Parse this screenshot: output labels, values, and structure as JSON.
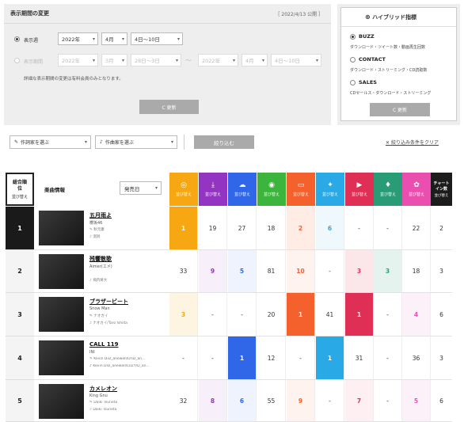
{
  "period": {
    "title": "表示期間の変更",
    "published": "［ 2022/4/13 公開 ］",
    "week_label": "表示週",
    "week_year": "2022年",
    "week_month": "4月",
    "week_range": "4日〜10日",
    "range_label": "表示期間",
    "from_year": "2022年",
    "from_month": "3月",
    "from_range": "28日〜3日",
    "tilde": "〜",
    "to_year": "2022年",
    "to_month": "4月",
    "to_range": "4日〜10日",
    "note": "詳細な表示期間の変更は有料会員のみとなります。",
    "update_label": "C 更新"
  },
  "hybrid": {
    "title": "ハイブリッド指標",
    "options": [
      {
        "name": "BUZZ",
        "desc": "ダウンロード・ツイート数・動画再生回数"
      },
      {
        "name": "CONTACT",
        "desc": "ダウンロード・ストリーミング・CD読取数"
      },
      {
        "name": "SALES",
        "desc": "CDセールス・ダウンロード・ストリーミング"
      }
    ],
    "update_label": "C 更新"
  },
  "filters": {
    "lyricist": "作詞家を選ぶ",
    "composer": "作曲家を選ぶ",
    "narrow": "絞り込む",
    "clear": "絞り込み条件をクリア"
  },
  "header": {
    "overall": "総合順位",
    "sort": "並び替え",
    "song_info": "楽曲情報",
    "release": "発売日",
    "chart_in": "チャートイン数",
    "columns": [
      {
        "name": "sales-column",
        "icon": "cd-icon",
        "color": "#f7a711"
      },
      {
        "name": "download-column",
        "icon": "download-icon",
        "color": "#9334c2"
      },
      {
        "name": "streaming-column",
        "icon": "cloud-icon",
        "color": "#2f67e8"
      },
      {
        "name": "radio-column",
        "icon": "radio-icon",
        "color": "#3cb53c"
      },
      {
        "name": "karaoke-room-column",
        "icon": "tv-icon",
        "color": "#f4612d"
      },
      {
        "name": "twitter-column",
        "icon": "twitter-icon",
        "color": "#29a9e6"
      },
      {
        "name": "youtube-column",
        "icon": "youtube-icon",
        "color": "#e02f55"
      },
      {
        "name": "karaoke-column",
        "icon": "microphone-icon",
        "color": "#2a9b77"
      },
      {
        "name": "gyao-column",
        "icon": "gyao-icon",
        "color": "#ea4fb0"
      }
    ]
  },
  "rows": [
    {
      "rank": "1",
      "title": "五月雨よ",
      "artist": "櫻坂46",
      "credit1": "秋元康",
      "credit2": "温詞",
      "values": [
        "1",
        "19",
        "27",
        "18",
        "2",
        "6",
        "-",
        "-",
        "22"
      ],
      "chartin": "2"
    },
    {
      "rank": "2",
      "title": "残響散歌",
      "artist": "Aimer(エメ)",
      "credit1": "",
      "credit2": "飛内将大",
      "values": [
        "33",
        "9",
        "5",
        "81",
        "10",
        "-",
        "3",
        "3",
        "18"
      ],
      "chartin": "3"
    },
    {
      "rank": "3",
      "title": "ブラザービート",
      "artist": "Snow Man",
      "credit1": "ナオカイ",
      "credit2": "ナオカイ/Taro Ishida",
      "values": [
        "3",
        "-",
        "-",
        "20",
        "1",
        "41",
        "1",
        "-",
        "4"
      ],
      "chartin": "6"
    },
    {
      "rank": "4",
      "title": "CALL 119",
      "artist": "INI",
      "credit1": "Kevin DiD_anewell/DriD_an...",
      "credit2": "Kevin DiD_anewell/LUZY/D_an...",
      "values": [
        "-",
        "-",
        "1",
        "12",
        "-",
        "1",
        "31",
        "-",
        "36"
      ],
      "chartin": "3"
    },
    {
      "rank": "5",
      "title": "カメレオン",
      "artist": "King Gnu",
      "credit1": "Daiki Tsuneta",
      "credit2": "Daiki Tsuneta",
      "values": [
        "32",
        "8",
        "6",
        "55",
        "9",
        "-",
        "7",
        "-",
        "5"
      ],
      "chartin": "6"
    }
  ]
}
